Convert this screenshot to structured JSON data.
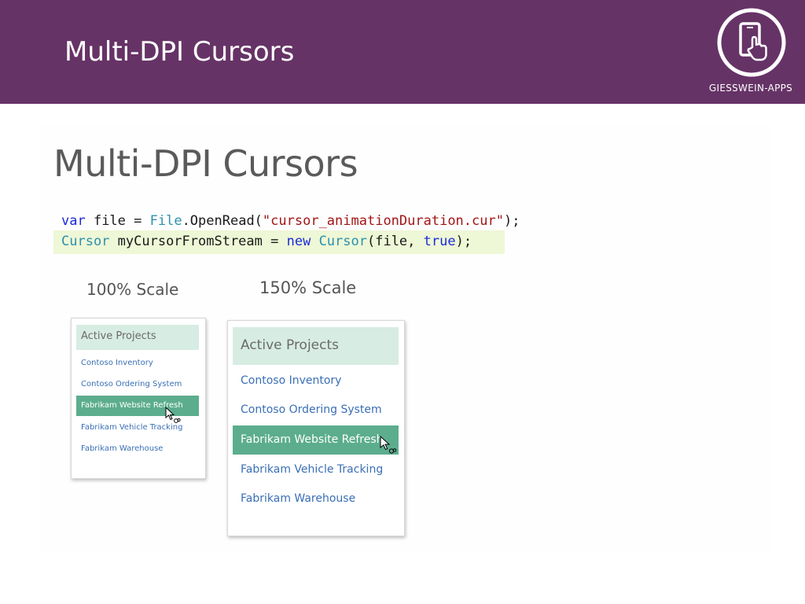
{
  "slide": {
    "title": "Multi-DPI Cursors",
    "brand": "GIESSWEIN-APPS",
    "banner_color": "#663366",
    "logo_icon": "tablet-touch-icon"
  },
  "screenshot": {
    "title": "Multi-DPI Cursors",
    "code": {
      "line1": {
        "kw_var": "var",
        "t1": " file = ",
        "type_file": "File",
        "t2": ".OpenRead(",
        "str": "\"cursor_animationDuration.cur\"",
        "t3": ");"
      },
      "line2": {
        "type_cursor": "Cursor",
        "t1": " myCursorFromStream = ",
        "kw_new": "new",
        "t2": " ",
        "type_cursor2": "Cursor",
        "t3": "(file, ",
        "kw_true": "true",
        "t4": ");"
      }
    },
    "scales": [
      {
        "label": "100% Scale",
        "header": "Active Projects",
        "items": [
          "Contoso Inventory",
          "Contoso Ordering System",
          "Fabrikam Website Refresh",
          "Fabrikam Vehicle Tracking",
          "Fabrikam Warehouse"
        ],
        "selected": "Fabrikam Website Refresh"
      },
      {
        "label": "150% Scale",
        "header": "Active Projects",
        "items": [
          "Contoso Inventory",
          "Contoso Ordering System",
          "Fabrikam Website Refresh",
          "Fabrikam Vehicle Tracking",
          "Fabrikam Warehouse"
        ],
        "selected": "Fabrikam Website Refresh"
      }
    ],
    "colors": {
      "header_bg": "#d7ece2",
      "selected_bg": "#5cad8e",
      "link": "#3a6fb5",
      "highlight": "#eef7d6"
    },
    "cursor_icon": "busy-arrow-cursor-icon"
  }
}
